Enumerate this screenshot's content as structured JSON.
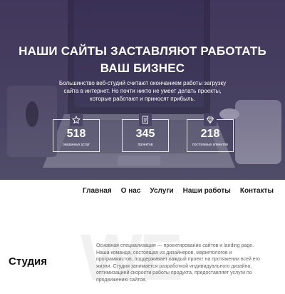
{
  "hero": {
    "title_line1": "НАШИ САЙТЫ ЗАСТАВЛЯЮТ РАБОТАТЬ",
    "title_line2": "ВАШ БИЗНЕС",
    "subtitle_line1": "Большинство веб-студий считают окончанием работы загрузку",
    "subtitle_line2": "сайта в интернет. Но почти никто не умеет делать проекты,",
    "subtitle_line3": "которые работают и приносят прибыль."
  },
  "stats": [
    {
      "icon": "star-icon",
      "value": "518",
      "label": "оказанных услуг"
    },
    {
      "icon": "document-icon",
      "value": "345",
      "label": "проектов"
    },
    {
      "icon": "diamond-icon",
      "value": "218",
      "label": "постоянных клиентов"
    }
  ],
  "nav": {
    "items": [
      "Главная",
      "О нас",
      "Услуги",
      "Наши работы",
      "Контакты"
    ]
  },
  "studio": {
    "background_letters": "WE",
    "title": "Студия",
    "text": "Основная специализация — проектирование сайтов и landing page. Наша команда, состоящая из дизайнеров, маркетологов и программистов, поддерживает каждый проект на протяжении всей его жизни. Студия занимается разработкой индивидуального дизайна, оптимизацией скорости работы продукта, предоставляет услуги по продвижению сайтов."
  }
}
